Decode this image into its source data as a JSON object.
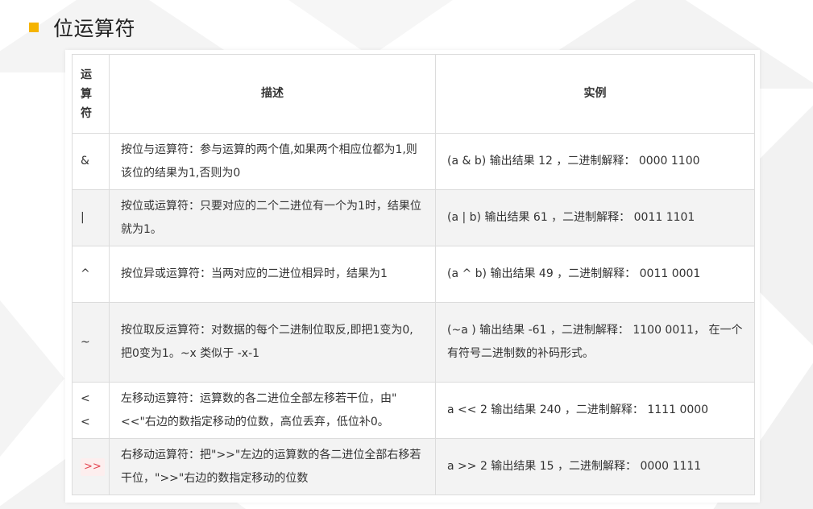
{
  "title": "位运算符",
  "table": {
    "headers": {
      "operator": "运\n算\n符",
      "description": "描述",
      "example": "实例"
    },
    "rows": [
      {
        "op": "&",
        "desc": "按位与运算符：参与运算的两个值,如果两个相应位都为1,则该位的结果为1,否则为0",
        "example": "(a & b) 输出结果 12 ，二进制解释： 0000 1100"
      },
      {
        "op": "|",
        "desc": "按位或运算符：只要对应的二个二进位有一个为1时，结果位就为1。",
        "example": "(a | b) 输出结果 61 ，二进制解释： 0011 1101"
      },
      {
        "op": "^",
        "desc": "按位异或运算符：当两对应的二进位相异时，结果为1",
        "example": "(a ^ b) 输出结果 49 ，二进制解释： 0011 0001"
      },
      {
        "op": "~",
        "desc": "按位取反运算符：对数据的每个二进制位取反,即把1变为0,把0变为1。~x 类似于 -x-1",
        "example": "(~a ) 输出结果 -61 ，二进制解释： 1100 0011， 在一个有符号二进制数的补码形式。"
      },
      {
        "op": "<\n<",
        "desc": "左移动运算符：运算数的各二进位全部左移若干位，由\"<<\"右边的数指定移动的位数，高位丢弃，低位补0。",
        "example": "a << 2 输出结果 240 ，二进制解释： 1111 0000"
      },
      {
        "op": ">>",
        "desc": "右移动运算符：把\">>\"左边的运算数的各二进位全部右移若干位，\">>\"右边的数指定移动的位数",
        "example": "a >> 2 输出结果 15 ，二进制解释： 0000 1111"
      }
    ]
  },
  "colors": {
    "bullet": "#f5b400",
    "tag_text": "#e3434f",
    "tag_bg": "#fdeeee",
    "row_alt": "#f3f3f3"
  }
}
